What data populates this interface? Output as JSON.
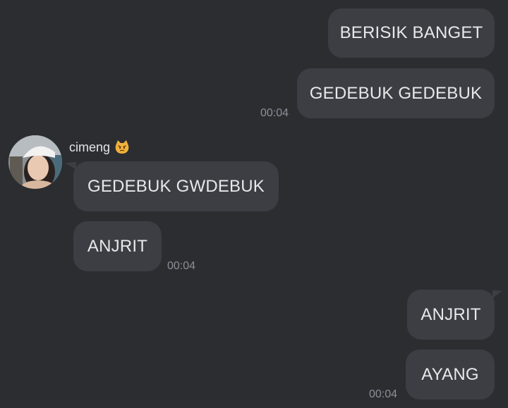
{
  "chat": {
    "messages": [
      {
        "side": "out",
        "text": "BERISIK BANGET"
      },
      {
        "side": "out",
        "text": "GEDEBUK GEDEBUK",
        "time": "00:04"
      },
      {
        "side": "in",
        "text": "GEDEBUK GWDEBUK"
      },
      {
        "side": "in",
        "text": "ANJRIT",
        "time": "00:04"
      },
      {
        "side": "out",
        "text": "ANJRIT"
      },
      {
        "side": "out",
        "text": "AYANG",
        "time": "00:04"
      }
    ],
    "sender": {
      "name": "cimeng",
      "emoji_icon": "angry-cat-emoji-icon"
    }
  },
  "colors": {
    "background": "#2b2d31",
    "bubble": "#3c3e44",
    "text": "#e8e8ea",
    "timestamp": "#8c8f96"
  }
}
